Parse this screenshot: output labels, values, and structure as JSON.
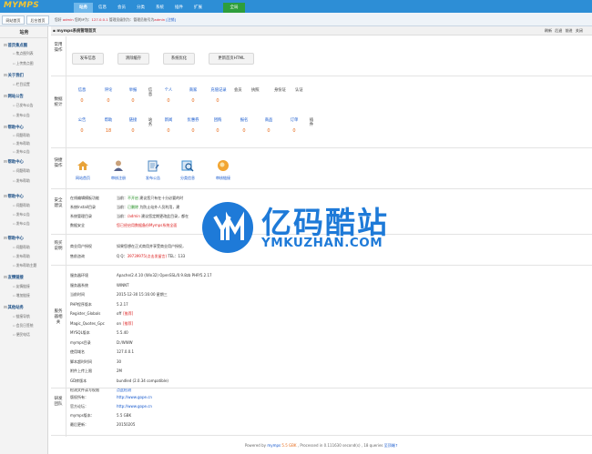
{
  "app": {
    "logo_main": "MYMPS",
    "home_button": "全局"
  },
  "topnav": [
    "站务",
    "信息",
    "会员",
    "分类",
    "系统",
    "插件",
    "扩展"
  ],
  "subbar": {
    "tabs": [
      "网站首页",
      "后台首页"
    ],
    "info_prefix": "您好",
    "user": "admin",
    "login_ip_label": "您的IP为：",
    "login_ip": "127.0.0.1",
    "role_text": "管理员级别为：管理员账号为",
    "user2": "admin",
    "logout": "[注销]"
  },
  "sidebar": {
    "title": "站务",
    "groups": [
      {
        "label": "首页焦点图",
        "items": [
          "焦点图列表",
          "上传焦点图"
        ]
      },
      {
        "label": "关于我们",
        "items": [
          "栏目设置"
        ]
      },
      {
        "label": "网站公告",
        "items": [
          "已发布公告",
          "发布公告"
        ]
      },
      {
        "label": "帮助中心",
        "items": [
          "问题帮助",
          "发布帮助",
          "发布公告"
        ]
      },
      {
        "label": "帮助中心",
        "items": [
          "问题帮助",
          "发布帮助"
        ]
      },
      {
        "label": "帮助中心",
        "items": [
          "问题帮助",
          "发布公告",
          "发布公告"
        ]
      },
      {
        "label": "帮助中心",
        "items": [
          "问题帮助",
          "发布帮助",
          "发布帮助主题"
        ]
      },
      {
        "label": "友情链接",
        "items": [
          "友情链接",
          "增加链接"
        ]
      },
      {
        "label": "其他站务",
        "items": [
          "链接导航",
          "会员日签统",
          "便民电话"
        ]
      }
    ]
  },
  "main": {
    "title": "mymps系统管理首页",
    "header_links": [
      "刷新",
      "后退",
      "前进",
      "关闭"
    ]
  },
  "ops": {
    "label": "常用操作",
    "buttons": [
      "发布信息",
      "清除缓存",
      "系统优化",
      "更新首页HTML"
    ]
  },
  "stats": {
    "label": "数据统计",
    "row1": [
      {
        "label": "信息",
        "value": "0"
      },
      {
        "label": "评论",
        "value": "0"
      },
      {
        "label": "举报",
        "value": "0"
      }
    ],
    "row1_cat": "信息",
    "row1b": [
      {
        "label": "个人",
        "value": "0"
      },
      {
        "label": "商家",
        "value": "0"
      },
      {
        "label": "充值记录",
        "value": "0"
      }
    ],
    "row1_right": [
      "会员",
      "执照",
      "身份证",
      "认证"
    ],
    "row2": [
      {
        "label": "公告",
        "value": "0"
      },
      {
        "label": "帮助",
        "value": "18"
      },
      {
        "label": "链接",
        "value": "0"
      }
    ],
    "row2_cat": "站务",
    "row2b": [
      {
        "label": "新闻",
        "value": "0"
      },
      {
        "label": "优惠券",
        "value": "0"
      },
      {
        "label": "团购",
        "value": "0"
      },
      {
        "label": "报名",
        "value": "0"
      },
      {
        "label": "商品",
        "value": "0"
      },
      {
        "label": "订单",
        "value": "0"
      }
    ],
    "row2_right": "插件"
  },
  "quick": {
    "label": "快捷操作",
    "items": [
      "网站首页",
      "审核注册",
      "发布公告",
      "分类信息",
      "审核链接"
    ],
    "colors": [
      "#e8a33a",
      "#6c7fa6",
      "#4c88c4",
      "#3b8ed0",
      "#f2a531"
    ]
  },
  "security": {
    "label": "安全建议",
    "rows": [
      {
        "k": "在线编辑模板功能",
        "v_pre": "当前：",
        "v_status": "不开启",
        "v_rest": "建议您只有在十分必要的时"
      },
      {
        "k": "系统Install目录",
        "v_pre": "当前：",
        "v_status": "已删除",
        "v_rest": "为防止站外人员利用，建"
      },
      {
        "k": "系统管理目录",
        "v_pre": "当前：",
        "v_status": "/admin",
        "v_rest": "建议您定期更改此目录，都在"
      },
      {
        "k": "数据安全",
        "v_pre": "",
        "v_status": "",
        "v_rest": "您已经启用数据备份Mymps系统全面"
      }
    ]
  },
  "purchase": {
    "label": "购买说明",
    "rows": [
      {
        "k": "商业用户授权",
        "v": "如果您想在正式商用并享受商业用户授权，"
      },
      {
        "k": "售前咨询",
        "v_pre": "Q Q：",
        "v_hl": "39739975(点击发留言)",
        "v_rest": " TEL：133"
      }
    ]
  },
  "server": {
    "label": "服务器相关",
    "rows": [
      {
        "k": "服务器环境",
        "v": "Apache/2.4.10 (Win32) OpenSSL/0.9.8zb PHP/5.2.17"
      },
      {
        "k": "服务器系统",
        "v": "WINNT"
      },
      {
        "k": "当前时间",
        "v": "2015-12-30 15:16:00 星期三"
      },
      {
        "k": "PHP程序版本",
        "v": "5.2.17"
      },
      {
        "k": "Register_Globals",
        "v": "off",
        "v_red": "[推荐]"
      },
      {
        "k": "Magic_Quotes_Gpc",
        "v": "on",
        "v_red": "[推荐]"
      },
      {
        "k": "MYSQL版本",
        "v": "5.5.40"
      },
      {
        "k": "mymps目录",
        "v": "D:/WWW"
      },
      {
        "k": "使用域名",
        "v": "127.0.0.1"
      },
      {
        "k": "脚本超时时间",
        "v": "30"
      },
      {
        "k": "附件上传上限",
        "v": "2M"
      },
      {
        "k": "GD库版本",
        "v": "bundled (2.0.34 compatible)"
      },
      {
        "k": "检测文件读写权限",
        "v_blue": "点此检测"
      }
    ]
  },
  "team": {
    "label": "研发团队",
    "rows": [
      {
        "k": "版权所有：",
        "v": "http://www.gope.cn"
      },
      {
        "k": "官方论坛：",
        "v": "http://www.gope.cn"
      },
      {
        "k": "mymps版本：",
        "v": "5.5 GBK"
      },
      {
        "k": "最后更新：",
        "v": "20150205"
      }
    ]
  },
  "watermark": {
    "text": "亿码酷站",
    "sub": "YMKUZHAN.COM"
  },
  "footer": {
    "pre": "Powered by ",
    "brand": "mymps",
    "ver": "5.5 GBK",
    "mid": " , Processed in 0.111630 second(s) , 18 queries ",
    "link": "至顶端↑"
  }
}
